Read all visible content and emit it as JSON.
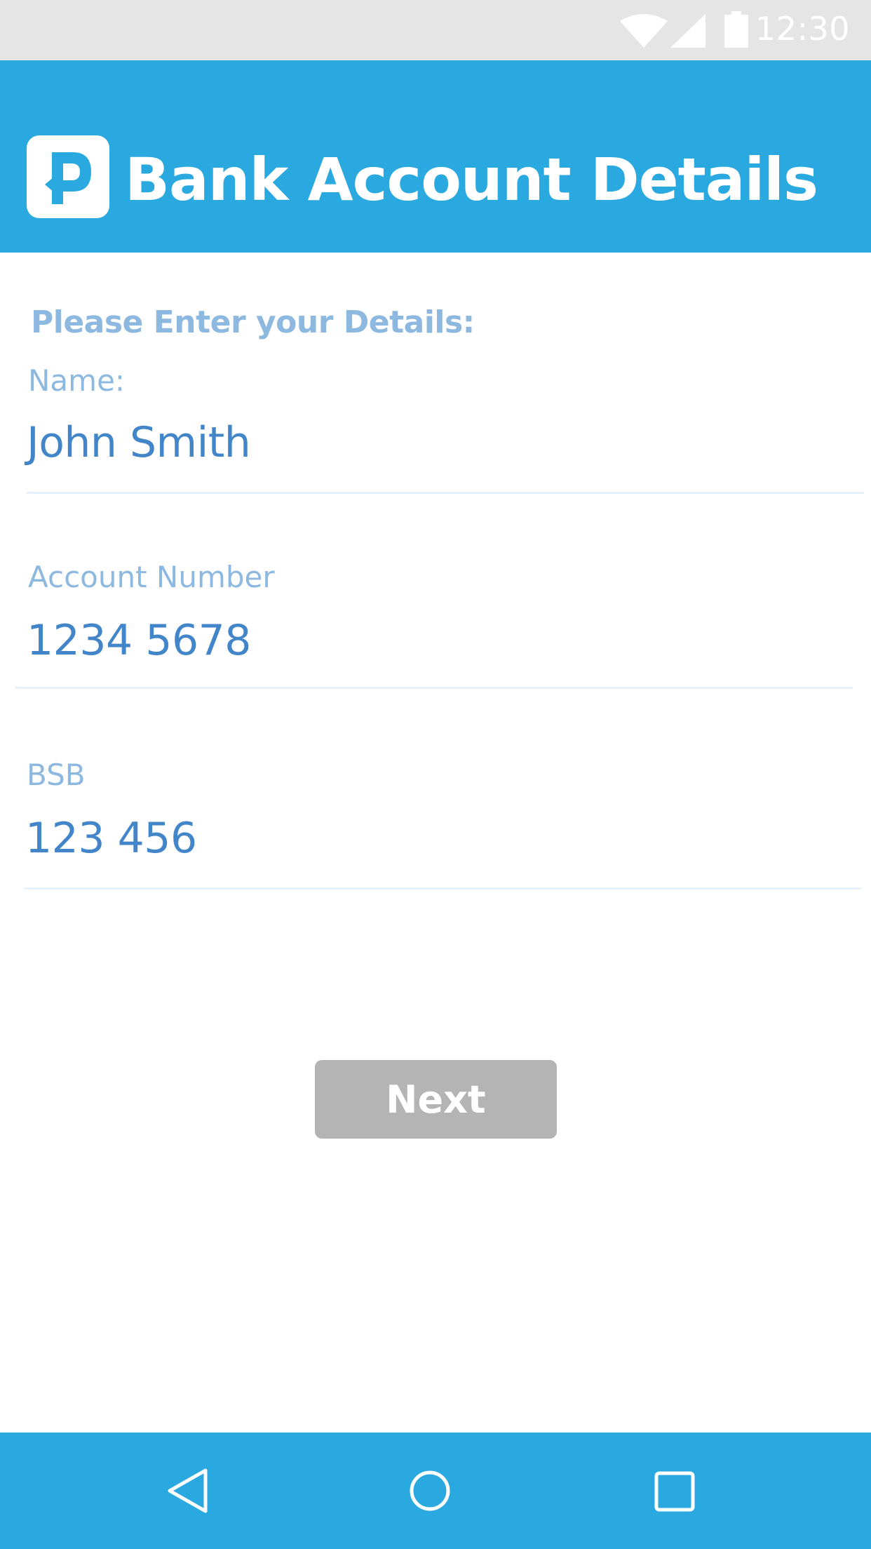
{
  "status_bar": {
    "time": "12:30",
    "icons": [
      "wifi-icon",
      "signal-icon",
      "battery-icon"
    ]
  },
  "app_bar": {
    "title": "Bank Account Details",
    "logo_icon": "p-logo-icon",
    "background_color": "#2aa9e0"
  },
  "form": {
    "heading": "Please Enter your Details:",
    "fields": [
      {
        "label": "Name:",
        "value": "John Smith"
      },
      {
        "label": "Account Number",
        "value": "1234 5678"
      },
      {
        "label": "BSB",
        "value": "123 456"
      }
    ]
  },
  "actions": {
    "next_label": "Next",
    "next_color": "#b4b4b4"
  },
  "nav_bar": {
    "buttons": [
      "back-icon",
      "home-icon",
      "recents-icon"
    ]
  },
  "colors": {
    "label": "#8db8e0",
    "value": "#4286c9",
    "accent": "#2aa9e0"
  }
}
